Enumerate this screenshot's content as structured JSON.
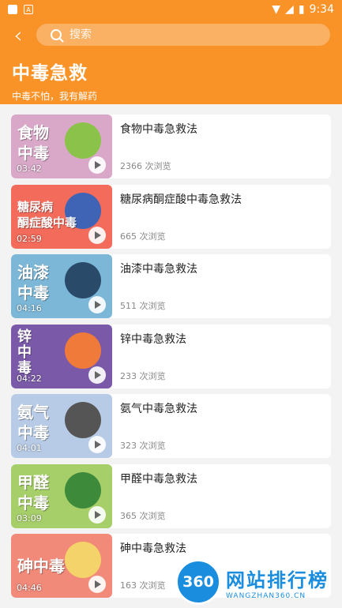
{
  "status": {
    "time": "9:34"
  },
  "search": {
    "placeholder": "搜索"
  },
  "header": {
    "title": "中毒急救",
    "subtitle": "中毒不怕，我有解药"
  },
  "items": [
    {
      "title": "食物中毒急救法",
      "views": "2366 次浏览",
      "duration": "03:42",
      "thumb_text": "食物\n中毒",
      "bg": "#d9a8c8",
      "deco": "#8bc34a"
    },
    {
      "title": "糖尿病酮症酸中毒急救法",
      "views": "665 次浏览",
      "duration": "02:59",
      "thumb_text": "糖尿病\n酮症酸中毒",
      "bg": "#f26b5b",
      "deco": "#3f63b5"
    },
    {
      "title": "油漆中毒急救法",
      "views": "511 次浏览",
      "duration": "04:16",
      "thumb_text": "油漆\n中毒",
      "bg": "#7cb7d8",
      "deco": "#2a4a6a"
    },
    {
      "title": "锌中毒急救法",
      "views": "233 次浏览",
      "duration": "04:22",
      "thumb_text": "锌\n中\n毒",
      "bg": "#7a5aa8",
      "deco": "#f07a3a"
    },
    {
      "title": "氨气中毒急救法",
      "views": "323 次浏览",
      "duration": "04:01",
      "thumb_text": "氨气\n中毒",
      "bg": "#b7cbe6",
      "deco": "#555555"
    },
    {
      "title": "甲醛中毒急救法",
      "views": "365 次浏览",
      "duration": "03:09",
      "thumb_text": "甲醛\n中毒",
      "bg": "#a6cf6a",
      "deco": "#3d8a3a"
    },
    {
      "title": "砷中毒急救法",
      "views": "163 次浏览",
      "duration": "04:46",
      "thumb_text": "砷中毒",
      "bg": "#f28a7a",
      "deco": "#f4d36a"
    }
  ],
  "watermark": {
    "logo": "360",
    "main": "网站排行榜",
    "sub": "WANGZHAN360.CN"
  }
}
